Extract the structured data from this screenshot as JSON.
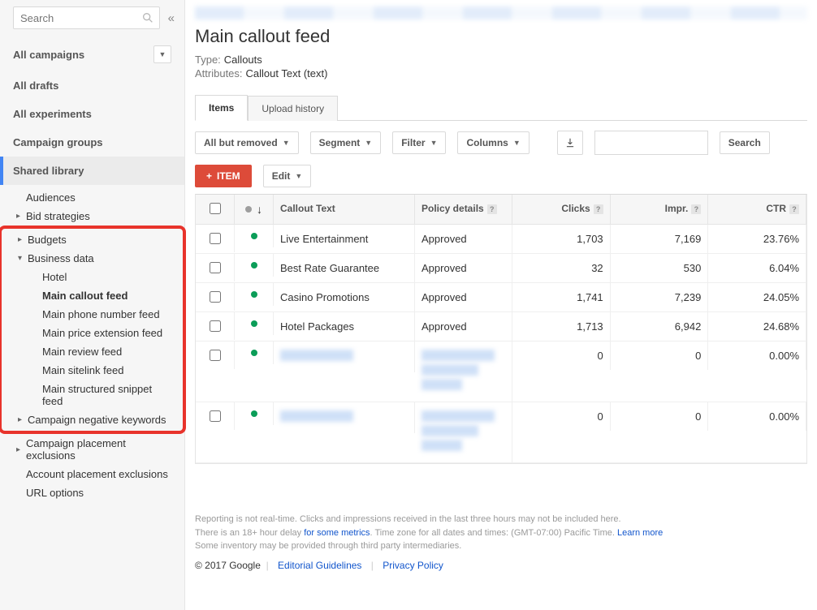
{
  "sidebar": {
    "search_placeholder": "Search",
    "nav": {
      "all_campaigns": "All campaigns",
      "all_drafts": "All drafts",
      "all_experiments": "All experiments",
      "campaign_groups": "Campaign groups",
      "shared_library": "Shared library"
    },
    "tree": {
      "audiences": "Audiences",
      "bid_strategies": "Bid strategies",
      "budgets": "Budgets",
      "business_data": "Business data",
      "bd_children": {
        "hotel": "Hotel",
        "main_callout_feed": "Main callout feed",
        "main_phone_number_feed": "Main phone number feed",
        "main_price_extension_feed": "Main price extension feed",
        "main_review_feed": "Main review feed",
        "main_sitelink_feed": "Main sitelink feed",
        "main_structured_snippet_feed": "Main structured snippet feed"
      },
      "campaign_negative_keywords": "Campaign negative keywords",
      "campaign_placement_exclusions": "Campaign placement exclusions",
      "account_placement_exclusions": "Account placement exclusions",
      "url_options": "URL options"
    }
  },
  "header": {
    "title": "Main callout feed",
    "type_label": "Type:",
    "type_value": "Callouts",
    "attributes_label": "Attributes:",
    "attributes_value": "Callout Text (text)"
  },
  "tabs": {
    "items": "Items",
    "upload_history": "Upload history"
  },
  "toolbar": {
    "all_but_removed": "All but removed",
    "segment": "Segment",
    "filter": "Filter",
    "columns": "Columns",
    "search": "Search"
  },
  "actions": {
    "item": "ITEM",
    "edit": "Edit"
  },
  "table": {
    "headers": {
      "callout_text": "Callout Text",
      "policy_details": "Policy details",
      "clicks": "Clicks",
      "impr": "Impr.",
      "ctr": "CTR"
    },
    "rows": [
      {
        "text": "Live Entertainment",
        "policy": "Approved",
        "clicks": "1,703",
        "impr": "7,169",
        "ctr": "23.76%"
      },
      {
        "text": "Best Rate Guarantee",
        "policy": "Approved",
        "clicks": "32",
        "impr": "530",
        "ctr": "6.04%"
      },
      {
        "text": "Casino Promotions",
        "policy": "Approved",
        "clicks": "1,741",
        "impr": "7,239",
        "ctr": "24.05%"
      },
      {
        "text": "Hotel Packages",
        "policy": "Approved",
        "clicks": "1,713",
        "impr": "6,942",
        "ctr": "24.68%"
      },
      {
        "text": "",
        "policy": "",
        "clicks": "0",
        "impr": "0",
        "ctr": "0.00%"
      },
      {
        "text": "",
        "policy": "",
        "clicks": "0",
        "impr": "0",
        "ctr": "0.00%"
      }
    ]
  },
  "footer": {
    "line1": "Reporting is not real-time. Clicks and impressions received in the last three hours may not be included here.",
    "line2a": "There is an 18+ hour delay ",
    "line2_link": "for some metrics",
    "line2b": ". Time zone for all dates and times: (GMT-07:00) Pacific Time. ",
    "learn_more": "Learn more",
    "line3": "Some inventory may be provided through third party intermediaries.",
    "copyright": "© 2017 Google",
    "editorial": "Editorial Guidelines",
    "privacy": "Privacy Policy"
  }
}
